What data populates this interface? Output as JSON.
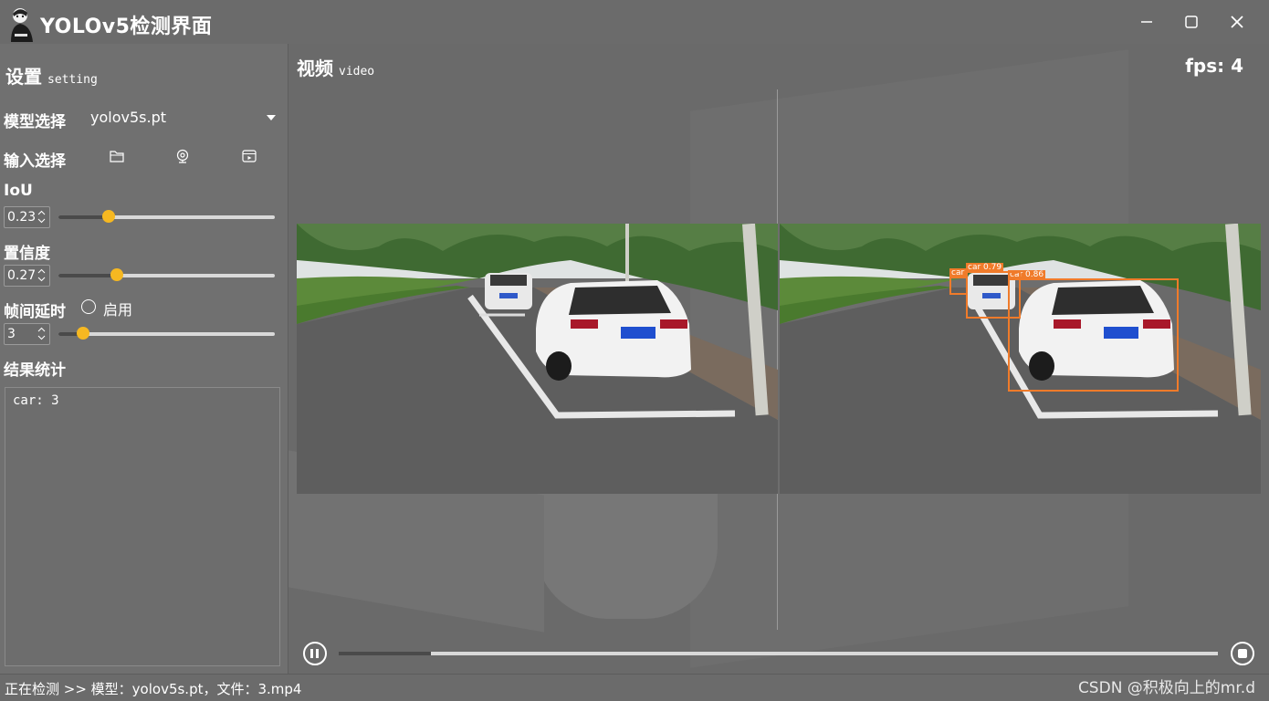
{
  "window": {
    "title": "YOLOv5检测界面",
    "minimize": "—",
    "maximize": "☐",
    "close": "✕"
  },
  "settings": {
    "title": "设置",
    "subtitle": "setting",
    "model_label": "模型选择",
    "model_value": "yolov5s.pt",
    "input_label": "输入选择",
    "iou_label": "IoU",
    "iou_value": "0.23",
    "iou_level": 0.23,
    "conf_label": "置信度",
    "conf_value": "0.27",
    "conf_level": 0.27,
    "delay_label": "帧间延时",
    "delay_enable_label": "启用",
    "delay_value": "3",
    "results_label": "结果统计",
    "results_text": "car: 3"
  },
  "video": {
    "title": "视频",
    "subtitle": "video",
    "fps_text": "fps: 4",
    "progress": 0.105,
    "detections": [
      {
        "label": "car 0.86"
      },
      {
        "label": "car 0.79"
      },
      {
        "label": "car"
      }
    ]
  },
  "status": {
    "text": "正在检测 >> 模型：yolov5s.pt，文件：3.mp4",
    "watermark": "CSDN @积极向上的mr.d"
  },
  "colors": {
    "accent": "#f6b821",
    "bbox": "#f07b2a",
    "background": "#6f6f6f"
  }
}
